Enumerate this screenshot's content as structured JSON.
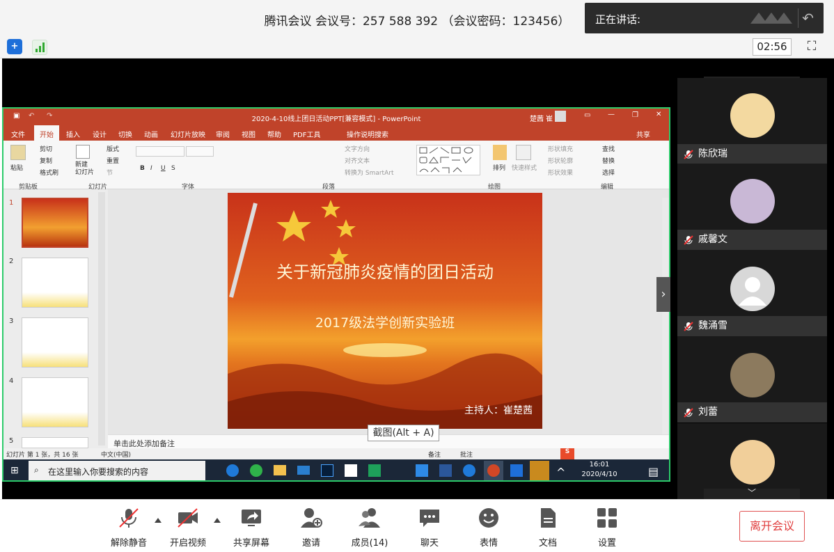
{
  "header": {
    "title": "腾讯会议 会议号：257 588 392 （会议密码：123456）",
    "speaking_label": "正在讲话:"
  },
  "toolbar2": {
    "timer": "02:56"
  },
  "ppt": {
    "window_title": "2020-4-10线上团日活动PPT[兼容模式] - PowerPoint",
    "user": "楚茜 崔",
    "tabs": [
      "文件",
      "开始",
      "插入",
      "设计",
      "切换",
      "动画",
      "幻灯片放映",
      "审阅",
      "视图",
      "帮助",
      "PDF工具",
      "操作说明搜索"
    ],
    "share": "共享",
    "ribbon": {
      "paste": "粘贴",
      "cut": "剪切",
      "copy": "复制",
      "format_painter": "格式刷",
      "new_slide": "新建\n幻灯片",
      "layout": "版式",
      "reset": "重置",
      "section": "节",
      "text_direction": "文字方向",
      "align_text": "对齐文本",
      "convert_smartart": "转换为 SmartArt",
      "arrange": "排列",
      "quick_styles": "快速样式",
      "shape_fill": "形状填充",
      "shape_outline": "形状轮廓",
      "shape_effects": "形状效果",
      "find": "查找",
      "replace": "替换",
      "select": "选择",
      "groups": [
        "剪贴板",
        "幻灯片",
        "字体",
        "段落",
        "绘图",
        "编辑"
      ]
    },
    "slide": {
      "title": "关于新冠肺炎疫情的团日活动",
      "subtitle": "2017级法学创新实验班",
      "host": "主持人：崔楚茜"
    },
    "thumb_numbers": [
      "1",
      "2",
      "3",
      "4",
      "5"
    ],
    "notes_placeholder": "单击此处添加备注",
    "status": {
      "slide_info": "幻灯片 第 1 张，共 16 张",
      "language": "中文(中国)",
      "notes": "备注",
      "comments": "批注"
    },
    "taskbar": {
      "search_placeholder": "在这里输入你要搜索的内容",
      "time": "16:01",
      "date": "2020/4/10"
    }
  },
  "tooltip": "截图(Alt + A)",
  "participants": [
    {
      "name": "陈欣瑞",
      "avatar_color": "#f3d9a0"
    },
    {
      "name": "戚馨文",
      "avatar_color": "#c9b8d6"
    },
    {
      "name": "魏涌雪",
      "avatar_color": "#d0d0d0"
    },
    {
      "name": "刘蕾",
      "avatar_color": "#8c7a5e"
    },
    {
      "name": "",
      "avatar_color": "#f1cf9a"
    }
  ],
  "bottom": {
    "unmute": "解除静音",
    "start_video": "开启视频",
    "share_screen": "共享屏幕",
    "invite": "邀请",
    "members": "成员(14)",
    "chat": "聊天",
    "emoji": "表情",
    "docs": "文档",
    "settings": "设置",
    "leave": "离开会议"
  },
  "colors": {
    "ppt_red": "#c0432a",
    "leave_red": "#e03c3c",
    "share_border": "#2ccb6a"
  }
}
